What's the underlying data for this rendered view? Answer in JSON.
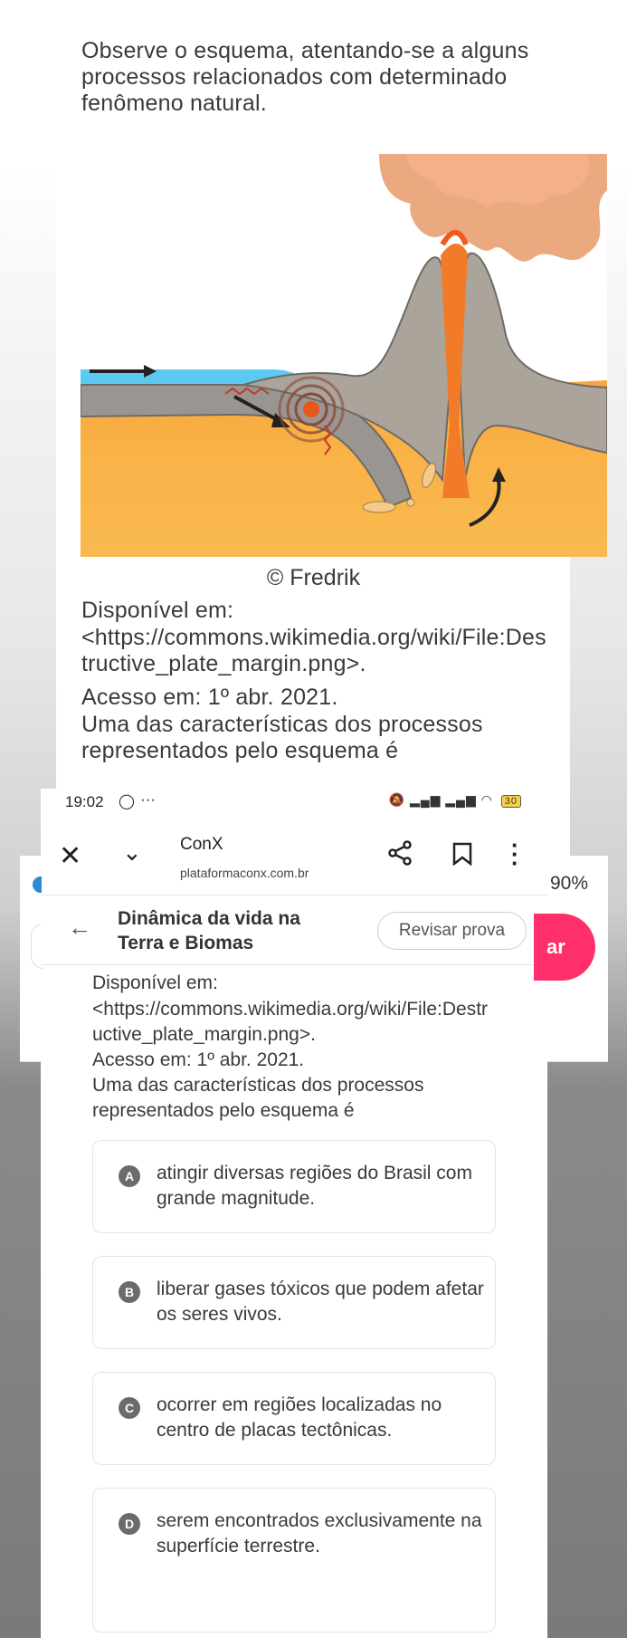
{
  "question": {
    "intro": "Observe o esquema, atentando-se a alguns processos relacionados com determinado fenômeno natural.",
    "credit": "© Fredrik",
    "source_label": "Disponível em:",
    "source_url": "<https://commons.wikimedia.org/wiki/File:Destructive_plate_margin.png>.",
    "access": "Acesso em: 1º abr. 2021.",
    "prompt": "Uma das características dos processos representados pelo esquema é"
  },
  "statusbar": {
    "time": "19:02",
    "dots": "···",
    "battery": "30"
  },
  "browser": {
    "title": "ConX",
    "url": "plataformaconx.com.br",
    "zoom": "90%"
  },
  "app_header": {
    "title": "Dinâmica da vida na Terra e Biomas",
    "review_button": "Revisar prova",
    "action_button": "ar"
  },
  "options": [
    {
      "letter": "A",
      "text": "atingir diversas regiões do Brasil com grande magnitude."
    },
    {
      "letter": "B",
      "text": "liberar gases tóxicos que podem afetar os seres vivos."
    },
    {
      "letter": "C",
      "text": "ocorrer em regiões localizadas no centro de placas tectônicas."
    },
    {
      "letter": "D",
      "text": "serem encontrados exclusivamente na superfície terrestre."
    }
  ],
  "colors": {
    "accent": "#ff2f6b",
    "link_blue": "#2a8bd6",
    "lava": "#f29a2e",
    "crust": "#a9a39a"
  }
}
